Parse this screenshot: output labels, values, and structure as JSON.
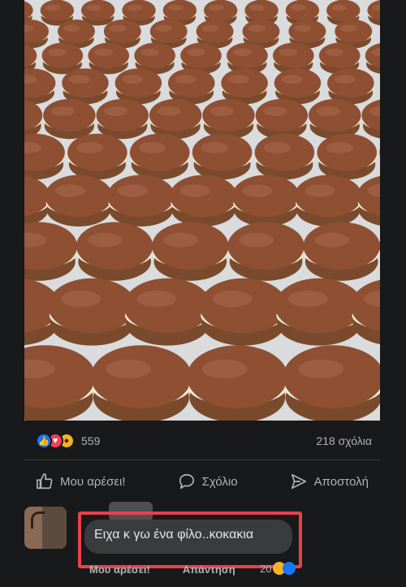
{
  "post": {
    "image_alt": "",
    "reaction_count": "559",
    "comment_count": "218 σχόλια",
    "reactions": [
      "like-icon",
      "love-icon",
      "wow-icon"
    ]
  },
  "actions": {
    "like_label": "Μου αρέσει!",
    "comment_label": "Σχόλιο",
    "share_label": "Αποστολή"
  },
  "comment": {
    "text": "Ειχα κ γω ένα φίλο..κοκακια",
    "like_action": "Μου αρέσει!",
    "reply_action": "Απάντηση",
    "reaction_count": "20"
  },
  "colors": {
    "background": "#18191a",
    "bubble": "#3a3b3c",
    "highlight": "#e8414a",
    "like_blue": "#1877f2",
    "love_red": "#f33e58",
    "wow_yellow": "#f7b125"
  }
}
